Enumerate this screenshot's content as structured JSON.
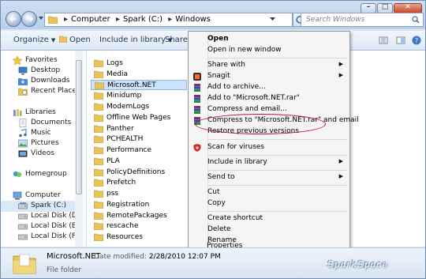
{
  "address": {
    "crumbs": [
      "Computer",
      "Spark (C:)",
      "Windows"
    ],
    "search_placeholder": "Search Windows"
  },
  "toolbar": {
    "organize": "Organize",
    "open": "Open",
    "include_in_library": "Include in library",
    "share_with": "Share wit"
  },
  "nav": {
    "favorites": "Favorites",
    "desktop": "Desktop",
    "downloads": "Downloads",
    "recent_places": "Recent Places",
    "libraries": "Libraries",
    "documents": "Documents",
    "music": "Music",
    "pictures": "Pictures",
    "videos": "Videos",
    "homegroup": "Homegroup",
    "computer": "Computer",
    "drives": [
      "Spark (C:)",
      "Local Disk (D:)",
      "Local Disk (E:)",
      "Local Disk (F:)"
    ]
  },
  "files": [
    "Logs",
    "Media",
    "Microsoft.NET",
    "Minidump",
    "ModemLogs",
    "Offline Web Pages",
    "Panther",
    "PCHEALTH",
    "Performance",
    "PLA",
    "PolicyDefinitions",
    "Prefetch",
    "pss",
    "Registration",
    "RemotePackages",
    "rescache",
    "Resources"
  ],
  "selected_file": "Microsoft.NET",
  "menu": {
    "open": "Open",
    "open_new_window": "Open in new window",
    "share_with": "Share with",
    "snagit": "Snagit",
    "add_to_archive": "Add to archive...",
    "add_to_rar": "Add to \"Microsoft.NET.rar\"",
    "compress_email": "Compress and email...",
    "compress_rar_email": "Compress to \"Microsoft.NET.rar\" and email",
    "restore_previous": "Restore previous versions",
    "scan_viruses": "Scan for viruses",
    "include_library": "Include in library",
    "send_to": "Send to",
    "cut": "Cut",
    "copy": "Copy",
    "create_shortcut": "Create shortcut",
    "delete": "Delete",
    "rename": "Rename",
    "properties": "Properties"
  },
  "details": {
    "name": "Microsoft.NET",
    "type": "File folder",
    "date_label": "Date modified:",
    "date_value": "2/28/2010 12:07 PM"
  },
  "watermark": "SparkSpace",
  "colors": {
    "highlight_ring": "#b3122c",
    "selection": "#cce4fb",
    "folder": "#e9c45a"
  }
}
